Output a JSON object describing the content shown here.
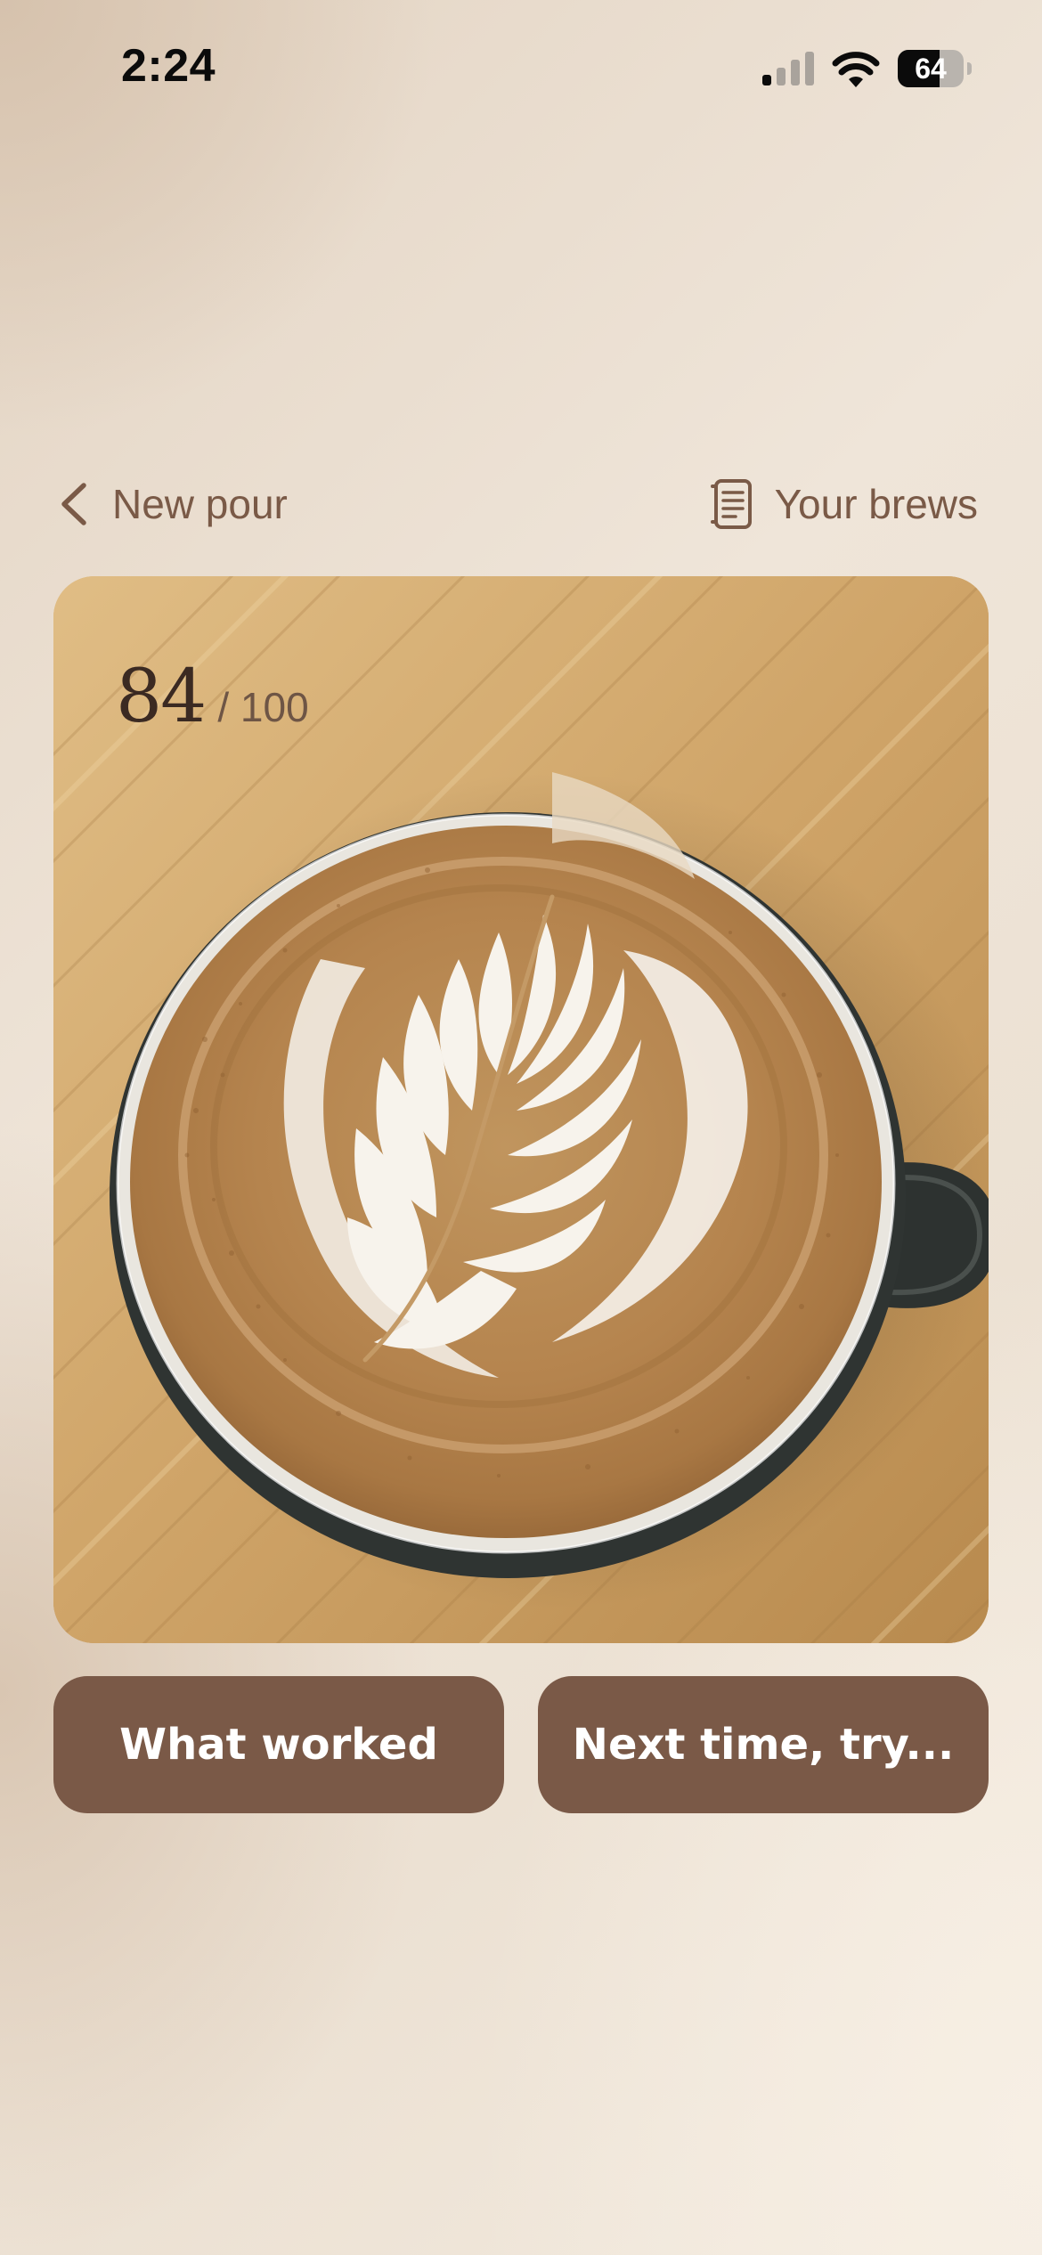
{
  "status_bar": {
    "time": "2:24",
    "battery_level": 64,
    "battery_text": "64",
    "signal_bars_active": 1,
    "signal_bars_total": 4,
    "icons": [
      "cellular-signal-icon",
      "wifi-icon",
      "battery-icon"
    ]
  },
  "nav": {
    "back_label": "New pour",
    "back_icon": "chevron-left-icon",
    "brews_label": "Your brews",
    "brews_icon": "notebook-icon"
  },
  "result": {
    "score": "84",
    "score_max": "/ 100",
    "photo_subject": "latte-art-photo"
  },
  "actions": {
    "what_worked_label": "What worked",
    "next_time_label": "Next time, try..."
  },
  "colors": {
    "accent": "#7a5947",
    "nav_text": "#7a5a47",
    "score_text": "#3b2a22",
    "background": "#ece1d3"
  }
}
